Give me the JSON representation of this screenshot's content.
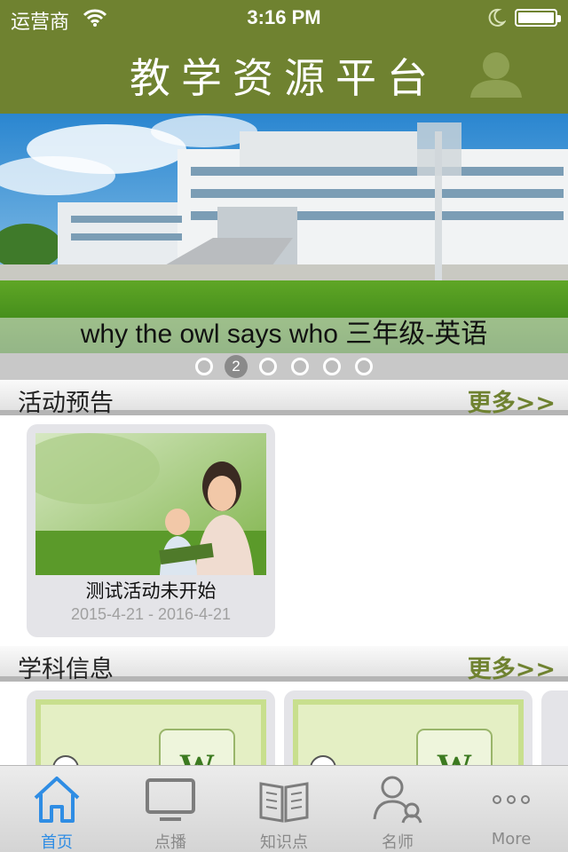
{
  "status_bar": {
    "carrier": "运营商",
    "time": "3:16 PM"
  },
  "header": {
    "title": "教学资源平台",
    "user_icon": "user-silhouette-icon"
  },
  "banner": {
    "caption": "why the owl says who 三年级-英语",
    "pager": {
      "count": 6,
      "active_index": 1,
      "active_label": "2"
    }
  },
  "activity_section": {
    "title": "活动预告",
    "more_label": "更多>>",
    "items": [
      {
        "title": "测试活动未开始",
        "date_range": "2015-4-21 - 2016-4-21"
      }
    ]
  },
  "subject_section": {
    "title": "学科信息",
    "more_label": "更多>>",
    "item_icon": "word-document-icon",
    "item_letter": "W"
  },
  "tab_bar": {
    "active_index": 0,
    "tabs": [
      {
        "label": "首页",
        "icon": "home-icon"
      },
      {
        "label": "点播",
        "icon": "tv-icon"
      },
      {
        "label": "知识点",
        "icon": "book-icon"
      },
      {
        "label": "名师",
        "icon": "teacher-icon"
      },
      {
        "label": "More",
        "icon": "more-dots-icon"
      }
    ]
  },
  "colors": {
    "header_green": "#6f8230",
    "more_green": "#6f8230",
    "tab_active_blue": "#2f8de4"
  }
}
